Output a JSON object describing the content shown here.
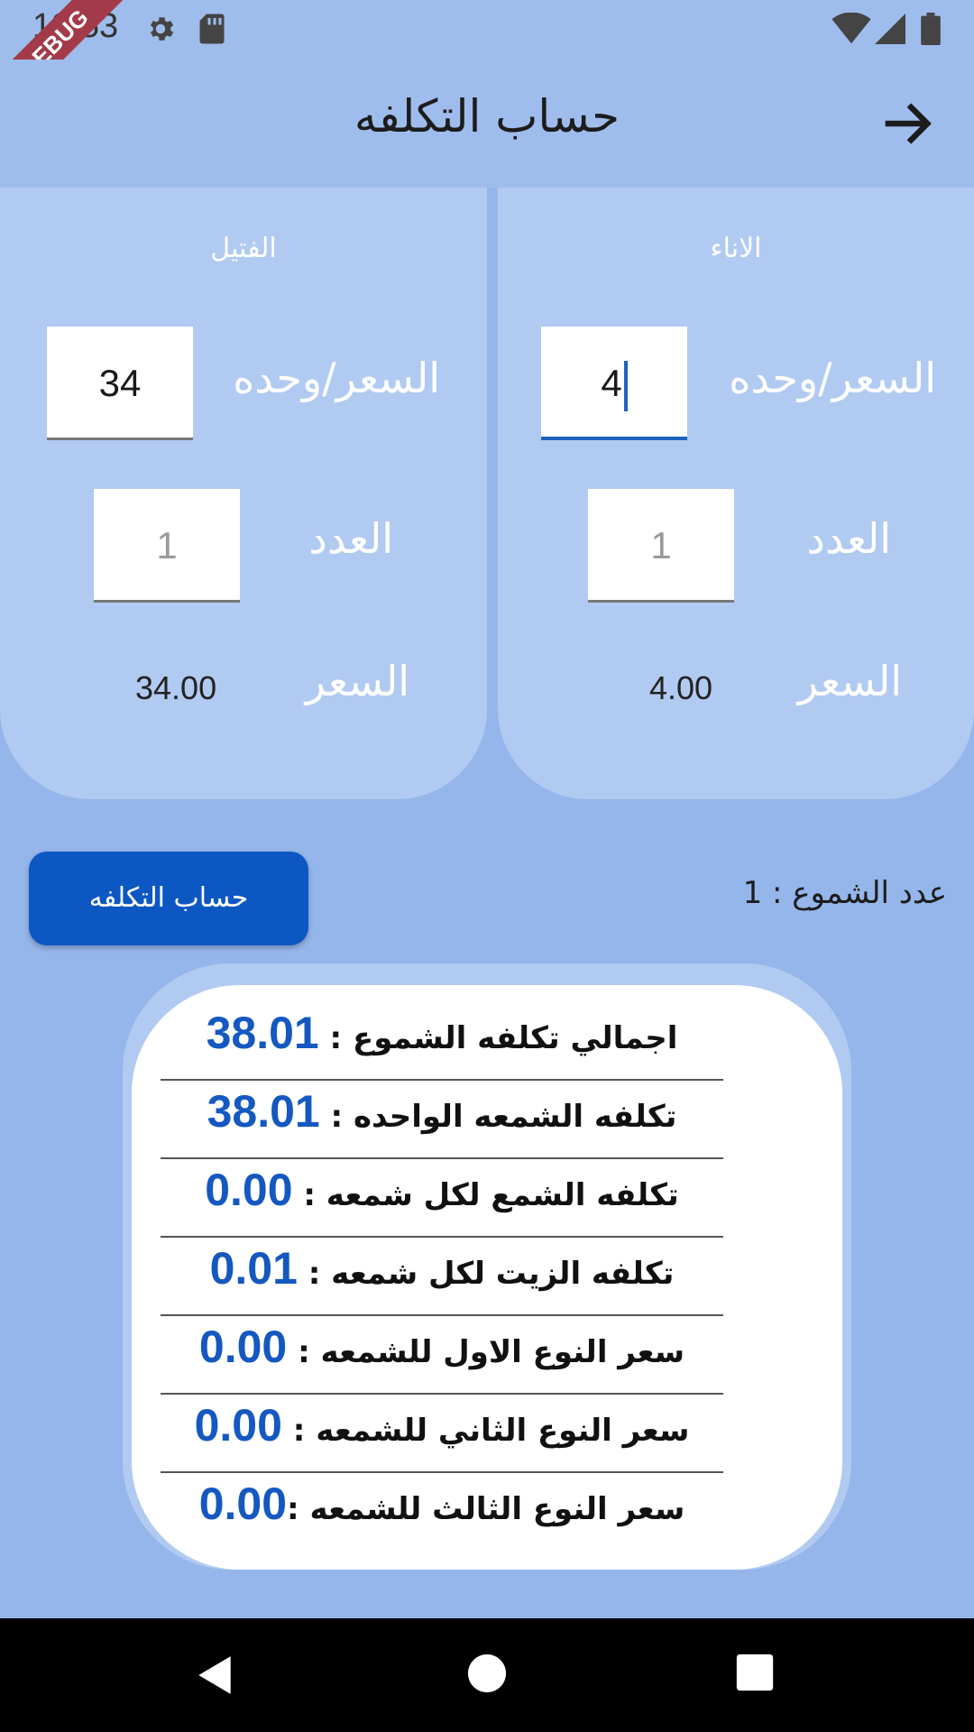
{
  "status_bar": {
    "time": "12:53",
    "debug_label": "DEBUG",
    "icons": [
      "gear-icon",
      "sd-card-icon",
      "wifi-icon",
      "signal-icon",
      "battery-icon"
    ]
  },
  "app_bar": {
    "title": "حساب التكلفه",
    "back_icon": "arrow-right-icon"
  },
  "colors": {
    "background": "#95b6ea",
    "card": "#b1caf1",
    "button": "#0d57c3",
    "value_text": "#1458c0"
  },
  "cards": {
    "wick": {
      "title": "الفتيل",
      "unit_price_label": "السعر/وحده",
      "unit_price_value": "34",
      "quantity_label": "العدد",
      "quantity_placeholder": "1",
      "price_label": "السعر",
      "price_value": "34.00"
    },
    "container": {
      "title": "الاناء",
      "unit_price_label": "السعر/وحده",
      "unit_price_value": "4",
      "quantity_label": "العدد",
      "quantity_placeholder": "1",
      "price_label": "السعر",
      "price_value": "4.00"
    }
  },
  "actions": {
    "calculate_label": "حساب التكلفه",
    "candle_count_label": "عدد الشموع : ",
    "candle_count_value": "1"
  },
  "results": [
    {
      "label": "اجمالي تكلفه الشموع : ",
      "value": "38.01"
    },
    {
      "label": "تكلفه الشمعه الواحده : ",
      "value": "38.01"
    },
    {
      "label": "تكلفه الشمع لكل شمعه : ",
      "value": "0.00"
    },
    {
      "label": "تكلفه الزيت لكل شمعه : ",
      "value": "0.01"
    },
    {
      "label": "سعر النوع الاول للشمعه : ",
      "value": "0.00"
    },
    {
      "label": "سعر النوع الثاني للشمعه : ",
      "value": "0.00"
    },
    {
      "label": "سعر النوع الثالث للشمعه :",
      "value": "0.00"
    }
  ],
  "nav_bar": {
    "icons": [
      "back-triangle-icon",
      "home-circle-icon",
      "recents-square-icon"
    ]
  }
}
